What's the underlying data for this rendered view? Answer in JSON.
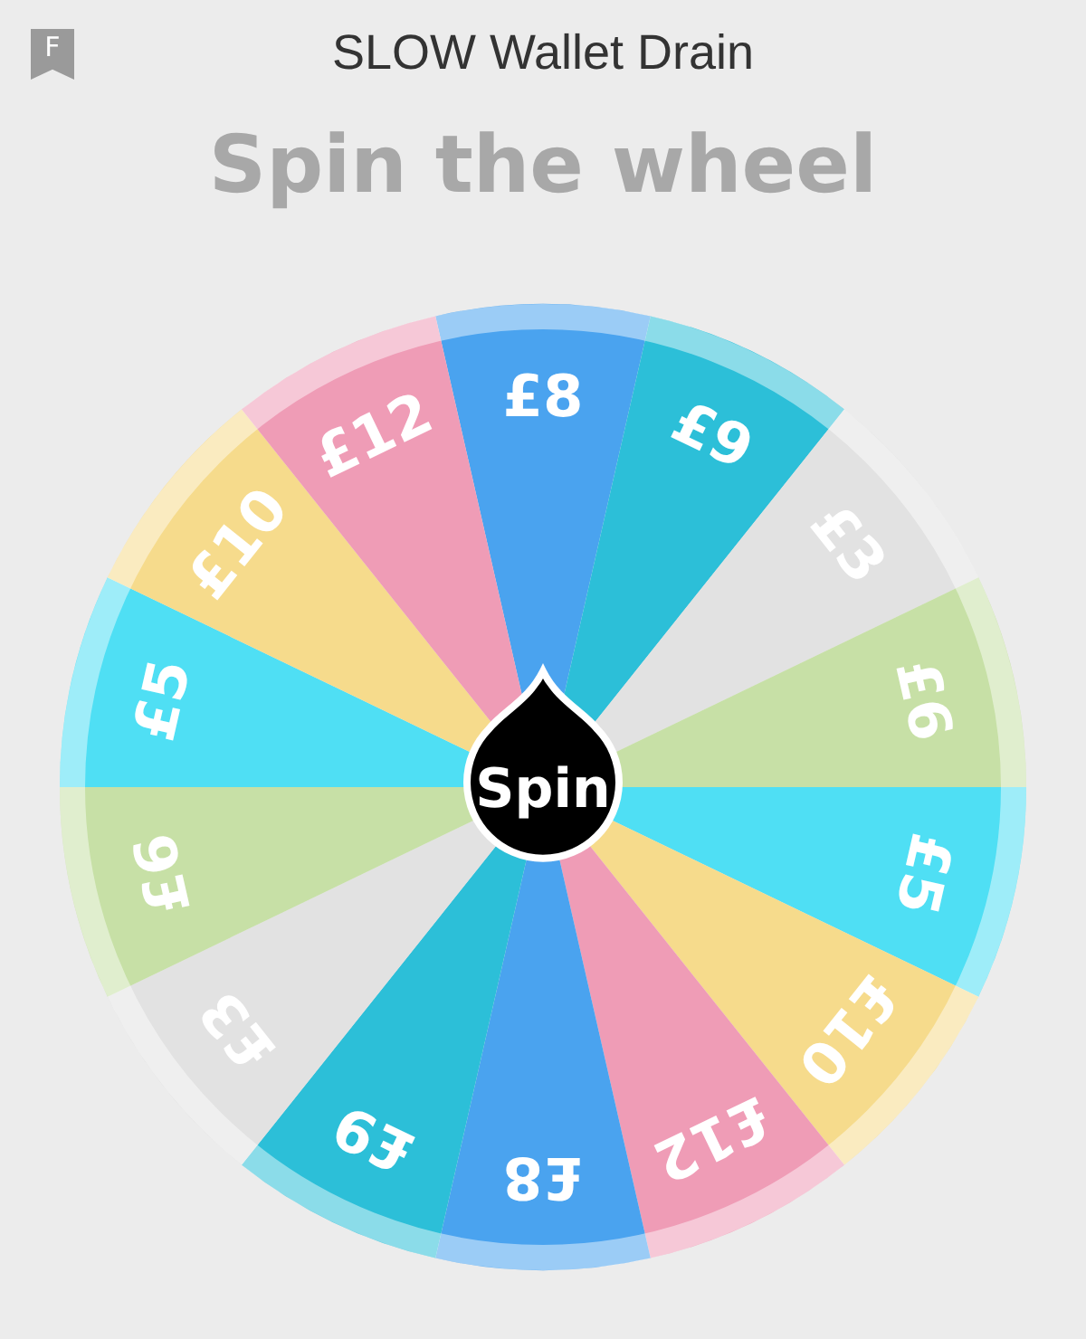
{
  "header": {
    "bookmark_letter": "F",
    "title": "SLOW Wallet Drain"
  },
  "heading": "Spin the wheel",
  "wheel": {
    "segments": [
      {
        "label": "£8",
        "color": "#4aa3ef"
      },
      {
        "label": "£9",
        "color": "#2cbfd8"
      },
      {
        "label": "£3",
        "color": "#e2e2e2"
      },
      {
        "label": "£6",
        "color": "#c7e0a6"
      },
      {
        "label": "£5",
        "color": "#4fdff4"
      },
      {
        "label": "£10",
        "color": "#f6db8c"
      },
      {
        "label": "£12",
        "color": "#ef9cb6"
      },
      {
        "label": "£8",
        "color": "#4aa3ef"
      },
      {
        "label": "£9",
        "color": "#2cbfd8"
      },
      {
        "label": "£3",
        "color": "#e2e2e2"
      },
      {
        "label": "£6",
        "color": "#c7e0a6"
      },
      {
        "label": "£5",
        "color": "#4fdff4"
      },
      {
        "label": "£10",
        "color": "#f6db8c"
      },
      {
        "label": "£12",
        "color": "#ef9cb6"
      }
    ],
    "button": "Spin"
  }
}
